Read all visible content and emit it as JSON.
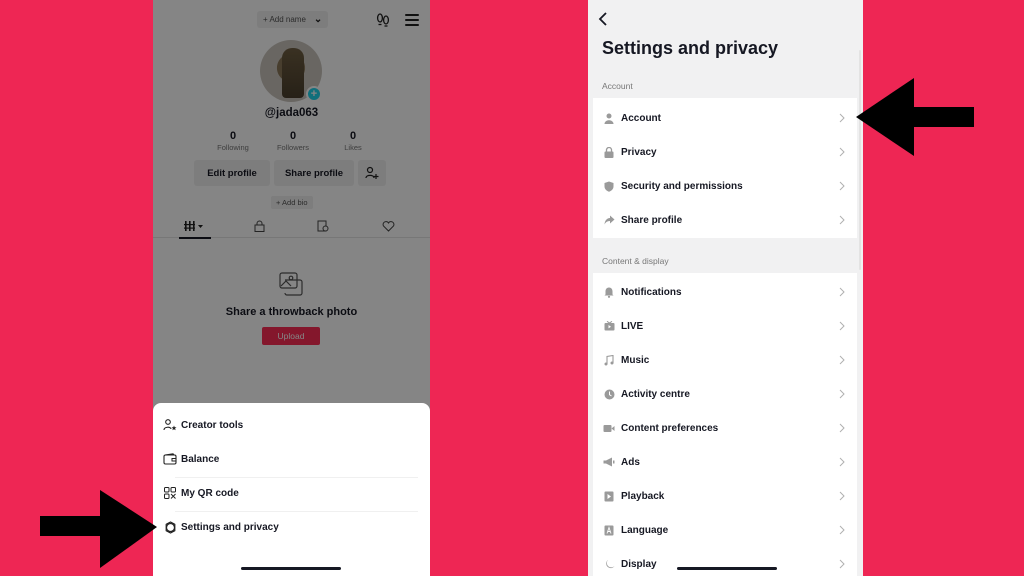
{
  "colors": {
    "background": "#ee2654",
    "accent": "#fe2c55",
    "avatar_plus": "#20d5ec",
    "arrow": "#000000"
  },
  "profile": {
    "add_name_label": "+ Add name",
    "username": "@jada063",
    "stats": [
      {
        "value": "0",
        "label": "Following"
      },
      {
        "value": "0",
        "label": "Followers"
      },
      {
        "value": "0",
        "label": "Likes"
      }
    ],
    "edit_profile_label": "Edit profile",
    "share_profile_label": "Share profile",
    "add_bio_label": "+ Add bio",
    "tabs": [
      "videos-grid",
      "private",
      "reposts",
      "liked"
    ],
    "empty_state": {
      "title": "Share a throwback photo",
      "button_label": "Upload"
    }
  },
  "menu_sheet": {
    "items": [
      {
        "icon": "creator-tools-icon",
        "label": "Creator tools"
      },
      {
        "icon": "wallet-icon",
        "label": "Balance"
      },
      {
        "icon": "qr-code-icon",
        "label": "My QR code"
      },
      {
        "icon": "gear-icon",
        "label": "Settings and privacy"
      }
    ]
  },
  "settings": {
    "title": "Settings and privacy",
    "sections": [
      {
        "label": "Account",
        "items": [
          {
            "icon": "person-icon",
            "label": "Account"
          },
          {
            "icon": "lock-icon",
            "label": "Privacy"
          },
          {
            "icon": "shield-icon",
            "label": "Security and permissions"
          },
          {
            "icon": "share-icon",
            "label": "Share profile"
          }
        ]
      },
      {
        "label": "Content & display",
        "items": [
          {
            "icon": "bell-icon",
            "label": "Notifications"
          },
          {
            "icon": "tv-icon",
            "label": "LIVE"
          },
          {
            "icon": "music-note-icon",
            "label": "Music"
          },
          {
            "icon": "clock-icon",
            "label": "Activity centre"
          },
          {
            "icon": "video-camera-icon",
            "label": "Content preferences"
          },
          {
            "icon": "megaphone-icon",
            "label": "Ads"
          },
          {
            "icon": "play-icon",
            "label": "Playback"
          },
          {
            "icon": "language-icon",
            "label": "Language"
          },
          {
            "icon": "display-icon",
            "label": "Display"
          }
        ]
      }
    ]
  }
}
